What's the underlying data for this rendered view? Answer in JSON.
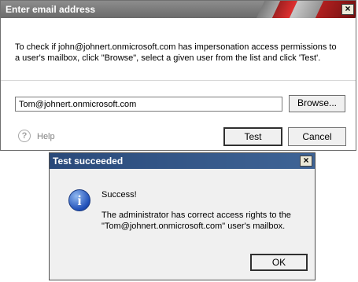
{
  "main_dialog": {
    "title": "Enter email address",
    "description": "To check if john@johnert.onmicrosoft.com has impersonation access permissions to a user's mailbox, click \"Browse\", select a given user from the list and click 'Test'.",
    "email_value": "Tom@johnert.onmicrosoft.com",
    "browse_label": "Browse...",
    "help_label": "Help",
    "test_label": "Test",
    "cancel_label": "Cancel",
    "close_glyph": "×"
  },
  "result_dialog": {
    "title": "Test succeeded",
    "heading": "Success!",
    "message": "The administrator has correct access rights to the \"Tom@johnert.onmicrosoft.com\" user's mailbox.",
    "ok_label": "OK",
    "close_glyph": "×",
    "icon_glyph": "i"
  },
  "icons": {
    "help": "question-circle",
    "info": "information-circle"
  },
  "colors": {
    "main_titlebar": "#7a7a7a",
    "result_titlebar": "#2f5186",
    "accent_red": "#c02020"
  }
}
